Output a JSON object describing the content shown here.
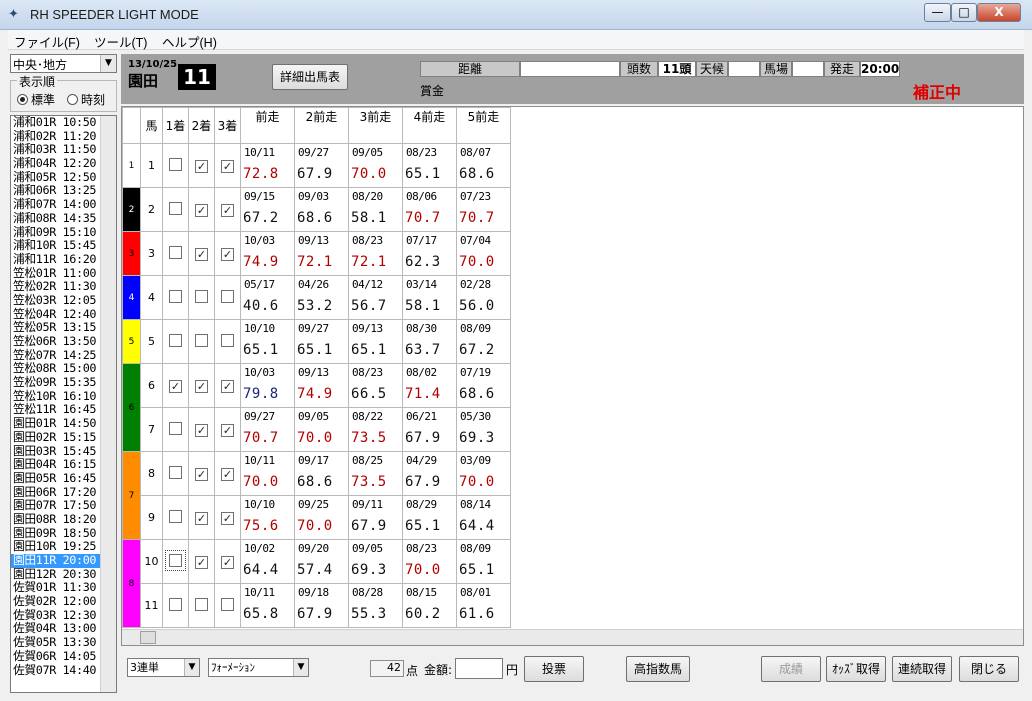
{
  "window": {
    "title": "RH SPEEDER LIGHT MODE",
    "min_glyph": "—",
    "max_glyph": "□",
    "close_glyph": "X"
  },
  "menu": [
    {
      "label": "ファイル(F)"
    },
    {
      "label": "ツール(T)"
    },
    {
      "label": "ヘルプ(H)"
    }
  ],
  "left": {
    "region": "中央･地方",
    "order_label": "表示順",
    "order_options": [
      {
        "label": "標準",
        "selected": true
      },
      {
        "label": "時刻",
        "selected": false
      }
    ]
  },
  "races": [
    {
      "label": "浦和01R  10:50"
    },
    {
      "label": "浦和02R  11:20"
    },
    {
      "label": "浦和03R  11:50"
    },
    {
      "label": "浦和04R  12:20"
    },
    {
      "label": "浦和05R  12:50"
    },
    {
      "label": "浦和06R  13:25"
    },
    {
      "label": "浦和07R  14:00"
    },
    {
      "label": "浦和08R  14:35"
    },
    {
      "label": "浦和09R  15:10"
    },
    {
      "label": "浦和10R  15:45"
    },
    {
      "label": "浦和11R  16:20"
    },
    {
      "label": "笠松01R  11:00"
    },
    {
      "label": "笠松02R  11:30"
    },
    {
      "label": "笠松03R  12:05"
    },
    {
      "label": "笠松04R  12:40"
    },
    {
      "label": "笠松05R  13:15"
    },
    {
      "label": "笠松06R  13:50"
    },
    {
      "label": "笠松07R  14:25"
    },
    {
      "label": "笠松08R  15:00"
    },
    {
      "label": "笠松09R  15:35"
    },
    {
      "label": "笠松10R  16:10"
    },
    {
      "label": "笠松11R  16:45"
    },
    {
      "label": "園田01R  14:50"
    },
    {
      "label": "園田02R  15:15"
    },
    {
      "label": "園田03R  15:45"
    },
    {
      "label": "園田04R  16:15"
    },
    {
      "label": "園田05R  16:45"
    },
    {
      "label": "園田06R  17:20"
    },
    {
      "label": "園田07R  17:50"
    },
    {
      "label": "園田08R  18:20"
    },
    {
      "label": "園田09R  18:50"
    },
    {
      "label": "園田10R  19:25"
    },
    {
      "label": "園田11R  20:00",
      "selected": true
    },
    {
      "label": "園田12R  20:30"
    },
    {
      "label": "佐賀01R  11:30"
    },
    {
      "label": "佐賀02R  12:00"
    },
    {
      "label": "佐賀03R  12:30"
    },
    {
      "label": "佐賀04R  13:00"
    },
    {
      "label": "佐賀05R  13:30"
    },
    {
      "label": "佐賀06R  14:05"
    },
    {
      "label": "佐賀07R  14:40"
    }
  ],
  "header": {
    "date": "13/10/25",
    "venue": "園田",
    "race_no": "11",
    "detail_button": "詳細出馬表",
    "distance_label": "距離",
    "distance_value": "",
    "count_label": "頭数",
    "count_value": "11頭",
    "weather_label": "天候",
    "weather_value": "",
    "track_label": "馬場",
    "track_value": "",
    "start_label": "発走",
    "start_value": "20:00",
    "prize_label": "賞金",
    "status": "補正中"
  },
  "grid": {
    "headers": {
      "horse": "馬",
      "first": "1着",
      "second": "2着",
      "third": "3着",
      "past": [
        "前走",
        "2前走",
        "3前走",
        "4前走",
        "5前走"
      ]
    },
    "frame_colors": {
      "1": "#ffffff",
      "2": "#000000",
      "3": "#ff0000",
      "4": "#0000ff",
      "5": "#ffff00",
      "6": "#008000",
      "7": "#ff8c00",
      "8": "#ff00ff"
    },
    "frame_text_colors": {
      "1": "#000000",
      "2": "#ffffff",
      "3": "#000000",
      "4": "#ffffff",
      "5": "#000000",
      "6": "#000000",
      "7": "#000000",
      "8": "#000000"
    },
    "colors": {
      "red": "#b00000",
      "black": "#111111",
      "blue": "#1a237e"
    },
    "rows": [
      {
        "frame": "1",
        "horse": "1",
        "c1": false,
        "c2": true,
        "c3": true,
        "past": [
          {
            "d": "10/11",
            "v": "72.8",
            "c": "red"
          },
          {
            "d": "09/27",
            "v": "67.9",
            "c": "black"
          },
          {
            "d": "09/05",
            "v": "70.0",
            "c": "red"
          },
          {
            "d": "08/23",
            "v": "65.1",
            "c": "black"
          },
          {
            "d": "08/07",
            "v": "68.6",
            "c": "black"
          }
        ]
      },
      {
        "frame": "2",
        "horse": "2",
        "c1": false,
        "c2": true,
        "c3": true,
        "past": [
          {
            "d": "09/15",
            "v": "67.2",
            "c": "black"
          },
          {
            "d": "09/03",
            "v": "68.6",
            "c": "black"
          },
          {
            "d": "08/20",
            "v": "58.1",
            "c": "black"
          },
          {
            "d": "08/06",
            "v": "70.7",
            "c": "red"
          },
          {
            "d": "07/23",
            "v": "70.7",
            "c": "red"
          }
        ]
      },
      {
        "frame": "3",
        "horse": "3",
        "c1": false,
        "c2": true,
        "c3": true,
        "past": [
          {
            "d": "10/03",
            "v": "74.9",
            "c": "red"
          },
          {
            "d": "09/13",
            "v": "72.1",
            "c": "red"
          },
          {
            "d": "08/23",
            "v": "72.1",
            "c": "red"
          },
          {
            "d": "07/17",
            "v": "62.3",
            "c": "black"
          },
          {
            "d": "07/04",
            "v": "70.0",
            "c": "red"
          }
        ]
      },
      {
        "frame": "4",
        "horse": "4",
        "c1": false,
        "c2": false,
        "c3": false,
        "past": [
          {
            "d": "05/17",
            "v": "40.6",
            "c": "black"
          },
          {
            "d": "04/26",
            "v": "53.2",
            "c": "black"
          },
          {
            "d": "04/12",
            "v": "56.7",
            "c": "black"
          },
          {
            "d": "03/14",
            "v": "58.1",
            "c": "black"
          },
          {
            "d": "02/28",
            "v": "56.0",
            "c": "black"
          }
        ]
      },
      {
        "frame": "5",
        "horse": "5",
        "c1": false,
        "c2": false,
        "c3": false,
        "past": [
          {
            "d": "10/10",
            "v": "65.1",
            "c": "black"
          },
          {
            "d": "09/27",
            "v": "65.1",
            "c": "black"
          },
          {
            "d": "09/13",
            "v": "65.1",
            "c": "black"
          },
          {
            "d": "08/30",
            "v": "63.7",
            "c": "black"
          },
          {
            "d": "08/09",
            "v": "67.2",
            "c": "black"
          }
        ]
      },
      {
        "frame": "6",
        "horse": "6",
        "c1": true,
        "c2": true,
        "c3": true,
        "past": [
          {
            "d": "10/03",
            "v": "79.8",
            "c": "blue"
          },
          {
            "d": "09/13",
            "v": "74.9",
            "c": "red"
          },
          {
            "d": "08/23",
            "v": "66.5",
            "c": "black"
          },
          {
            "d": "08/02",
            "v": "71.4",
            "c": "red"
          },
          {
            "d": "07/19",
            "v": "68.6",
            "c": "black"
          }
        ]
      },
      {
        "frame": "6",
        "horse": "7",
        "c1": false,
        "c2": true,
        "c3": true,
        "past": [
          {
            "d": "09/27",
            "v": "70.7",
            "c": "red"
          },
          {
            "d": "09/05",
            "v": "70.0",
            "c": "red"
          },
          {
            "d": "08/22",
            "v": "73.5",
            "c": "red"
          },
          {
            "d": "06/21",
            "v": "67.9",
            "c": "black"
          },
          {
            "d": "05/30",
            "v": "69.3",
            "c": "black"
          }
        ]
      },
      {
        "frame": "7",
        "horse": "8",
        "c1": false,
        "c2": true,
        "c3": true,
        "past": [
          {
            "d": "10/11",
            "v": "70.0",
            "c": "red"
          },
          {
            "d": "09/17",
            "v": "68.6",
            "c": "black"
          },
          {
            "d": "08/25",
            "v": "73.5",
            "c": "red"
          },
          {
            "d": "04/29",
            "v": "67.9",
            "c": "black"
          },
          {
            "d": "03/09",
            "v": "70.0",
            "c": "red"
          }
        ]
      },
      {
        "frame": "7",
        "horse": "9",
        "c1": false,
        "c2": true,
        "c3": true,
        "past": [
          {
            "d": "10/10",
            "v": "75.6",
            "c": "red"
          },
          {
            "d": "09/25",
            "v": "70.0",
            "c": "red"
          },
          {
            "d": "09/11",
            "v": "67.9",
            "c": "black"
          },
          {
            "d": "08/29",
            "v": "65.1",
            "c": "black"
          },
          {
            "d": "08/14",
            "v": "64.4",
            "c": "black"
          }
        ]
      },
      {
        "frame": "8",
        "horse": "10",
        "c1": false,
        "c2": true,
        "c3": true,
        "focus": true,
        "past": [
          {
            "d": "10/02",
            "v": "64.4",
            "c": "black"
          },
          {
            "d": "09/20",
            "v": "57.4",
            "c": "black"
          },
          {
            "d": "09/05",
            "v": "69.3",
            "c": "black"
          },
          {
            "d": "08/23",
            "v": "70.0",
            "c": "red"
          },
          {
            "d": "08/09",
            "v": "65.1",
            "c": "black"
          }
        ]
      },
      {
        "frame": "8",
        "horse": "11",
        "c1": false,
        "c2": false,
        "c3": false,
        "past": [
          {
            "d": "10/11",
            "v": "65.8",
            "c": "black"
          },
          {
            "d": "09/18",
            "v": "67.9",
            "c": "black"
          },
          {
            "d": "08/28",
            "v": "55.3",
            "c": "black"
          },
          {
            "d": "08/15",
            "v": "60.2",
            "c": "black"
          },
          {
            "d": "08/01",
            "v": "61.6",
            "c": "black"
          }
        ]
      }
    ]
  },
  "footer": {
    "bet_type": "3連単",
    "method": "ﾌｫｰﾒｰｼｮﾝ",
    "points": "42",
    "points_unit": "点",
    "amount_label": "金額:",
    "amount_value": "",
    "yen": "円",
    "vote_button": "投票",
    "top_horses_button": "高指数馬",
    "results_button": "成績",
    "odds_button": "ｵｯｽﾞ取得",
    "sequential_button": "連続取得",
    "close_button": "閉じる"
  }
}
